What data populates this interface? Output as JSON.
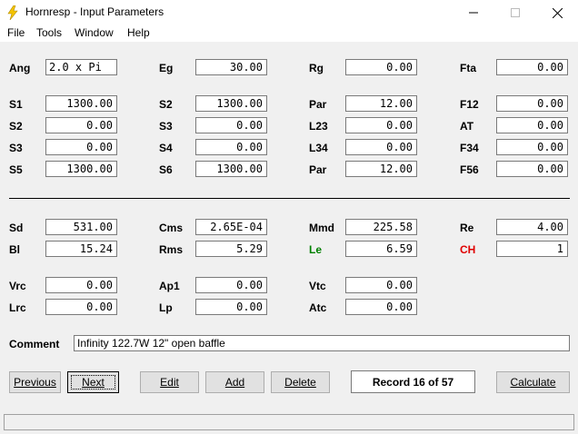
{
  "window": {
    "title": "Hornresp - Input Parameters",
    "min_icon": "minimize-icon",
    "max_icon": "maximize-icon",
    "close_icon": "close-icon"
  },
  "menu": [
    "File",
    "Tools",
    "Window",
    "Help"
  ],
  "params": {
    "Ang": "2.0 x Pi",
    "Eg": "30.00",
    "Rg": "0.00",
    "Fta": "0.00",
    "S1": "1300.00",
    "S2b": "1300.00",
    "Par": "12.00",
    "F12": "0.00",
    "S2": "0.00",
    "S3b": "0.00",
    "L23": "0.00",
    "AT": "0.00",
    "S3": "0.00",
    "S4": "0.00",
    "L34": "0.00",
    "F34": "0.00",
    "S5": "1300.00",
    "S6": "1300.00",
    "Par2": "12.00",
    "F56": "0.00",
    "Sd": "531.00",
    "Cms": "2.65E-04",
    "Mmd": "225.58",
    "Re": "4.00",
    "Bl": "15.24",
    "Rms": "5.29",
    "Le": "6.59",
    "CH": "1",
    "Vrc": "0.00",
    "Ap1": "0.00",
    "Vtc": "0.00",
    "Lrc": "0.00",
    "Lp": "0.00",
    "Atc": "0.00"
  },
  "labels": {
    "Ang": "Ang",
    "Eg": "Eg",
    "Rg": "Rg",
    "Fta": "Fta",
    "S1": "S1",
    "S2b": "S2",
    "Par": "Par",
    "F12": "F12",
    "S2": "S2",
    "S3b": "S3",
    "L23": "L23",
    "AT": "AT",
    "S3": "S3",
    "S4": "S4",
    "L34": "L34",
    "F34": "F34",
    "S5": "S5",
    "S6": "S6",
    "Par2": "Par",
    "F56": "F56",
    "Sd": "Sd",
    "Cms": "Cms",
    "Mmd": "Mmd",
    "Re": "Re",
    "Bl": "Bl",
    "Rms": "Rms",
    "Le": "Le",
    "CH": "CH",
    "Vrc": "Vrc",
    "Ap1": "Ap1",
    "Vtc": "Vtc",
    "Lrc": "Lrc",
    "Lp": "Lp",
    "Atc": "Atc",
    "Comment": "Comment"
  },
  "comment": "Infinity 122.7W 12\" open baffle",
  "buttons": {
    "previous": "Previous",
    "next": "Next",
    "edit": "Edit",
    "add": "Add",
    "delete": "Delete",
    "calculate": "Calculate"
  },
  "record": "Record 16 of 57",
  "colors": {
    "le_label": "#008000",
    "ch_label": "#e00000",
    "app_icon": "#f5c400"
  }
}
